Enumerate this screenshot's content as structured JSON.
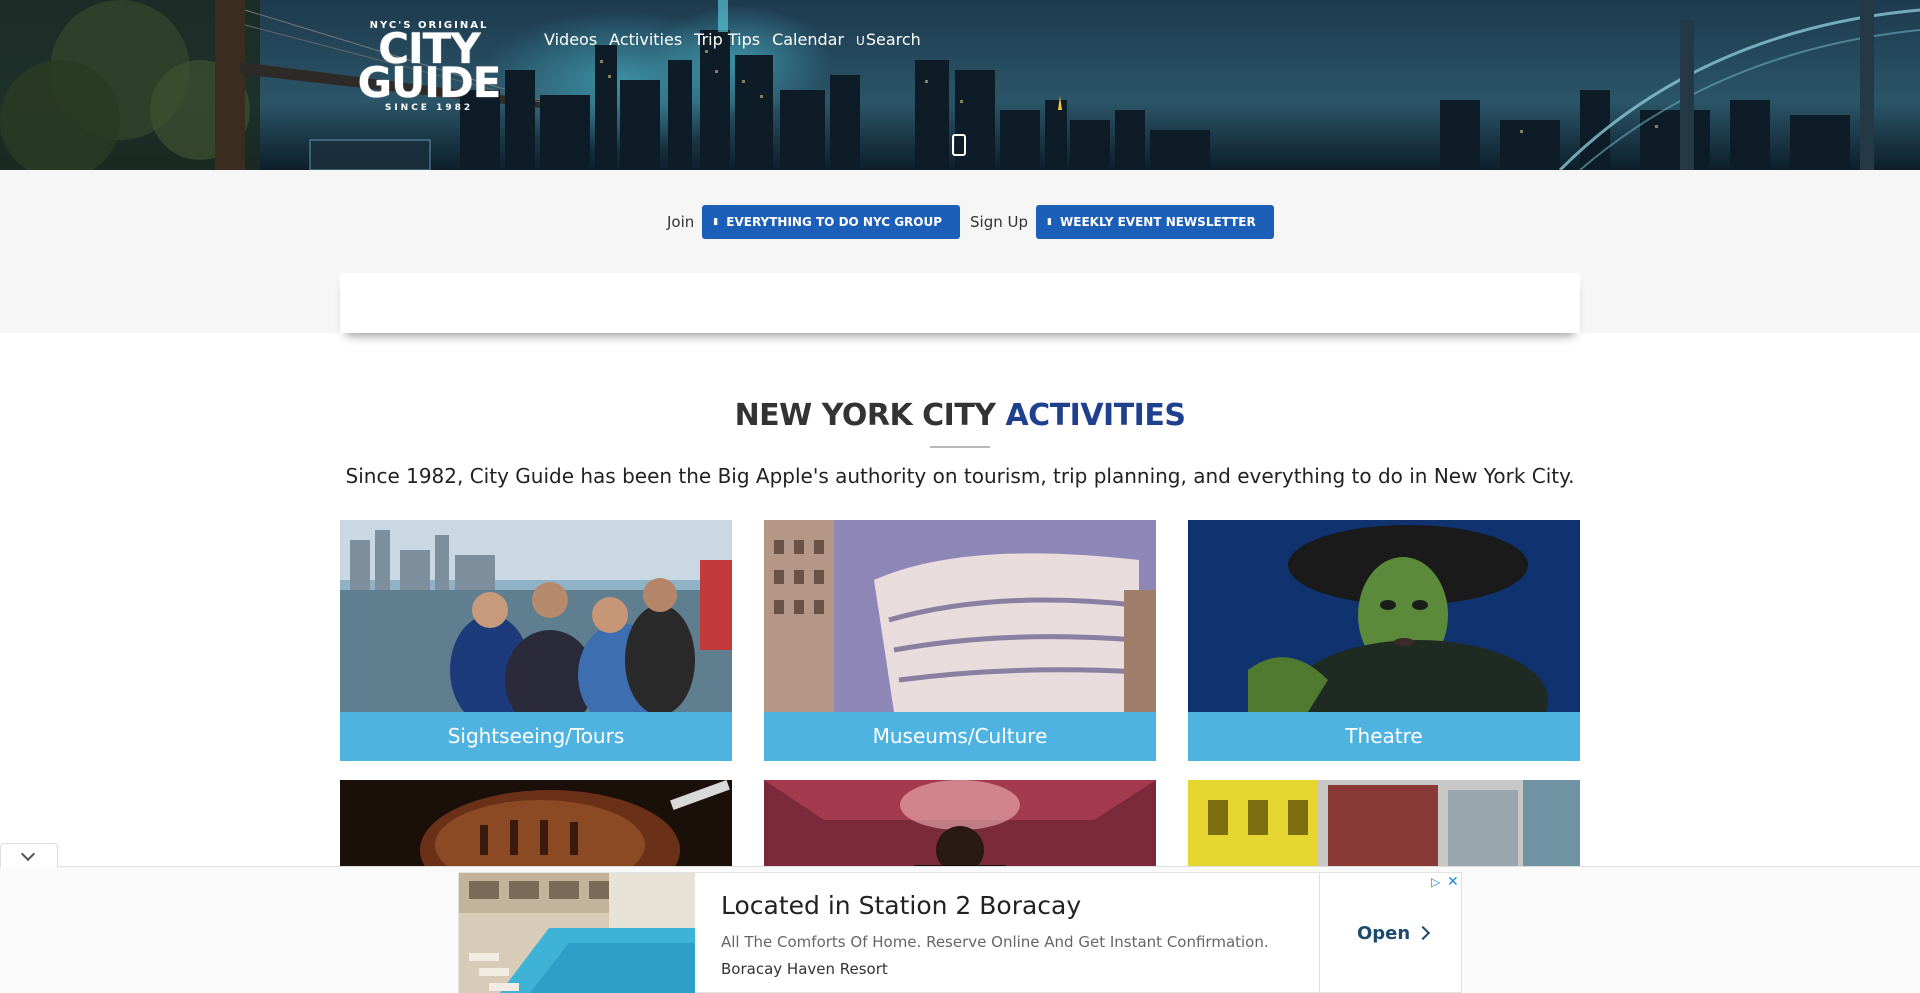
{
  "header": {
    "logo": {
      "top": "NYC'S ORIGINAL",
      "line1": "CITY",
      "line2": "GUIDE",
      "since": "SINCE 1982"
    },
    "nav": [
      {
        "label": "Videos"
      },
      {
        "label": "Activities"
      },
      {
        "label": "Trip Tips"
      },
      {
        "label": "Calendar"
      },
      {
        "label": "Search",
        "icon": "search-icon",
        "icon_glyph": "U"
      }
    ]
  },
  "join_bar": {
    "join_label": "Join",
    "group_button": "EVERYTHING TO DO NYC GROUP",
    "signup_label": "Sign Up",
    "newsletter_button": "WEEKLY EVENT NEWSLETTER"
  },
  "section": {
    "title_plain": "NEW YORK CITY",
    "title_accent": "ACTIVITIES",
    "intro": "Since 1982, City Guide has been the Big Apple's authority on tourism, trip planning, and everything to do in New York City."
  },
  "cards": [
    {
      "label": "Sightseeing/Tours"
    },
    {
      "label": "Museums/Culture"
    },
    {
      "label": "Theatre"
    }
  ],
  "colors": {
    "accent_blue": "#1f3f8f",
    "button_blue": "#1c5fb8",
    "caption_blue": "#4fb3e2"
  },
  "bottom_ad": {
    "headline": "Located in Station 2 Boracay",
    "description": "All The Comforts Of Home. Reserve Online And Get Instant Confirmation.",
    "advertiser": "Boracay Haven Resort",
    "cta": "Open",
    "close": "✕"
  }
}
